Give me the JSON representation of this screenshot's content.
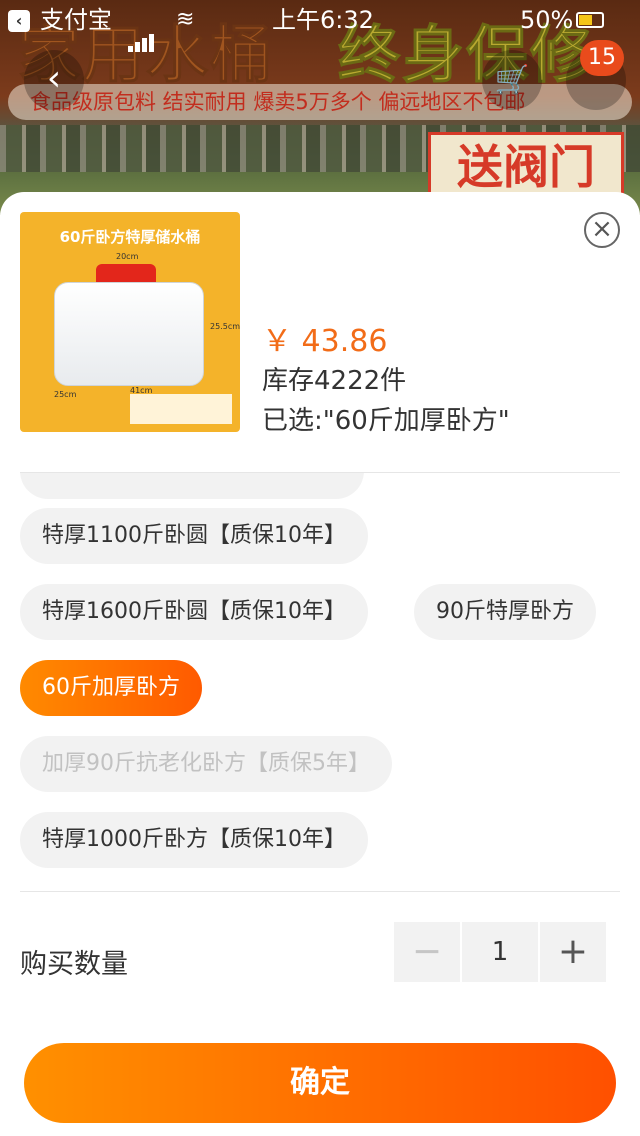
{
  "status_bar": {
    "app_name": "支付宝",
    "time": "上午6:32",
    "battery_pct": "50%"
  },
  "banner": {
    "title_left": "家用水桶",
    "title_right": "终身保修",
    "subtitle": "食品级原包料 结实耐用 爆卖5万多个  偏远地区不包邮",
    "badge": "送阀门",
    "cart_count": "15"
  },
  "product": {
    "thumb_title": "60斤卧方特厚储水桶",
    "thumb_dims": [
      "20cm",
      "25.5cm",
      "25cm",
      "41cm"
    ],
    "price": "￥ 43.86",
    "stock": "库存4222件",
    "selected": "已选:\"60斤加厚卧方\""
  },
  "options": [
    {
      "label": "特厚1100斤卧圆【质保10年】",
      "state": "normal"
    },
    {
      "label": "特厚1600斤卧圆【质保10年】",
      "state": "normal"
    },
    {
      "label": "90斤特厚卧方",
      "state": "normal"
    },
    {
      "label": "60斤加厚卧方",
      "state": "selected"
    },
    {
      "label": "加厚90斤抗老化卧方【质保5年】",
      "state": "disabled"
    },
    {
      "label": "特厚1000斤卧方【质保10年】",
      "state": "normal"
    }
  ],
  "quantity": {
    "label": "购买数量",
    "minus": "−",
    "value": "1",
    "plus": "+"
  },
  "confirm_label": "确定",
  "colors": {
    "accent": "#ff6a00",
    "price": "#f26c18"
  }
}
